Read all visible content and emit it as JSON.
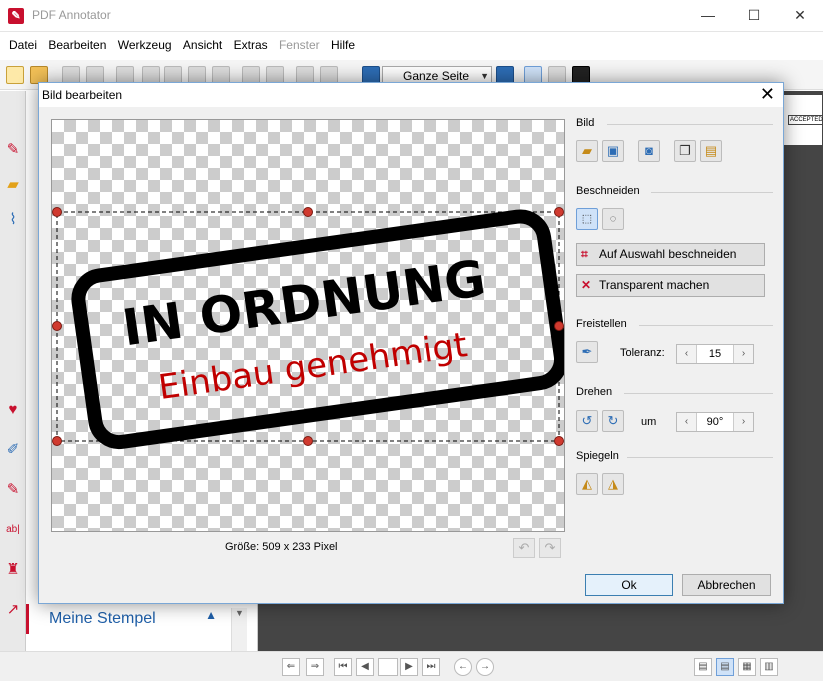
{
  "window": {
    "title": "PDF Annotator",
    "minimize": "—",
    "maximize": "☐",
    "close": "✕"
  },
  "menu": [
    "Datei",
    "Bearbeiten",
    "Werkzeug",
    "Ansicht",
    "Extras",
    "Fenster",
    "Hilfe"
  ],
  "menu_disabled": [
    "Fenster"
  ],
  "toolbar": {
    "zoom_value": "Ganze Seite"
  },
  "side_panel": {
    "header": "Meine Stempel"
  },
  "page_thumb": {
    "stamp_text": "ACCEPTED"
  },
  "dialog": {
    "title": "Bild bearbeiten",
    "image_size": "Größe: 509 x 233 Pixel",
    "stamp": {
      "line1": "IN ORDNUNG",
      "line2": "Einbau genehmigt",
      "line2_color": "#c00000"
    },
    "sections": {
      "bild": "Bild",
      "beschneiden": "Beschneiden",
      "freistellen": "Freistellen",
      "drehen": "Drehen",
      "spiegeln": "Spiegeln"
    },
    "crop_button": "Auf Auswahl beschneiden",
    "transparent_button": "Transparent machen",
    "toleranz_label": "Toleranz:",
    "toleranz_value": "15",
    "um_label": "um",
    "rotate_value": "90°",
    "ok": "Ok",
    "cancel": "Abbrechen"
  },
  "colors": {
    "accent": "#c8102e",
    "link_blue": "#1f5fa8",
    "dark_bg": "#454545"
  }
}
